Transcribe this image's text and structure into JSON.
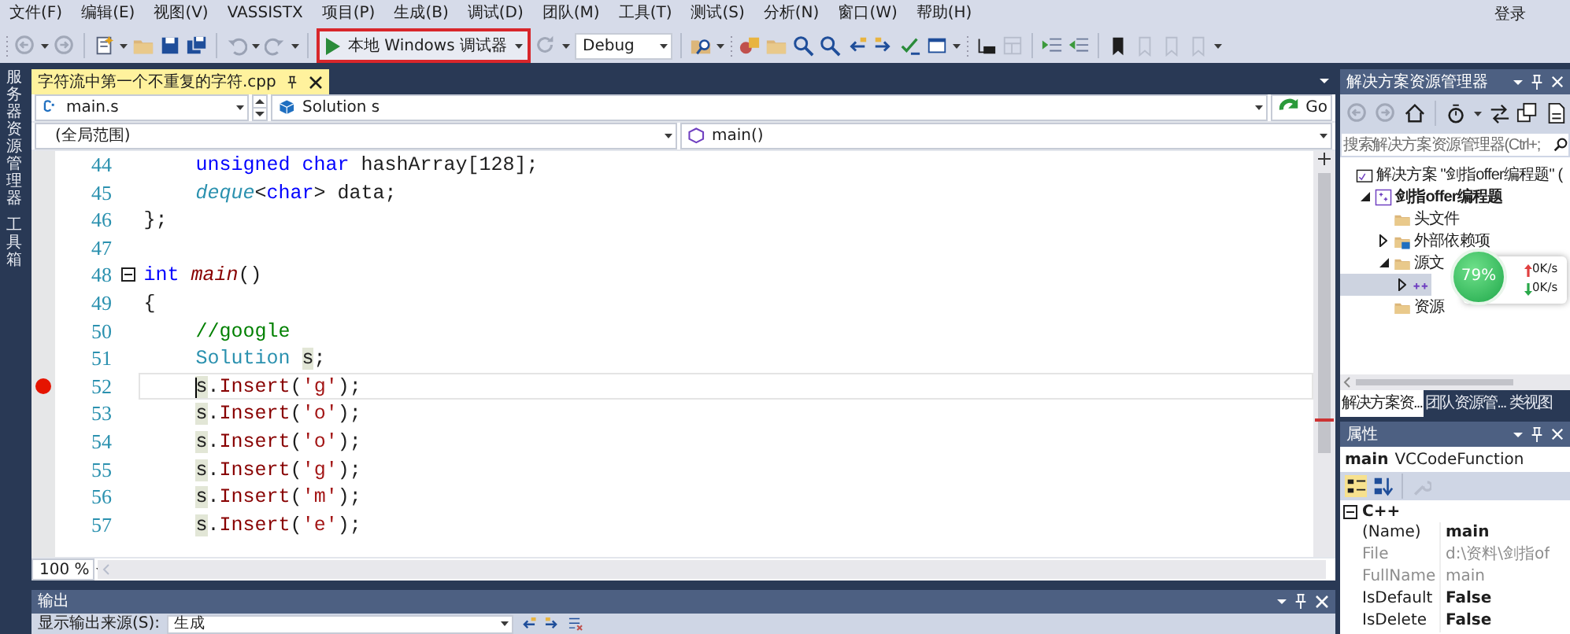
{
  "menu": [
    {
      "label": "文件(F)"
    },
    {
      "label": "编辑(E)"
    },
    {
      "label": "视图(V)"
    },
    {
      "label": "VASSISTX"
    },
    {
      "label": "项目(P)"
    },
    {
      "label": "生成(B)"
    },
    {
      "label": "调试(D)"
    },
    {
      "label": "团队(M)"
    },
    {
      "label": "工具(T)"
    },
    {
      "label": "测试(S)"
    },
    {
      "label": "分析(N)"
    },
    {
      "label": "窗口(W)"
    },
    {
      "label": "帮助(H)"
    }
  ],
  "sign_in": "登录",
  "toolbar": {
    "debug_button": "本地 Windows 调试器",
    "configuration": "Debug"
  },
  "side_tabs": [
    {
      "label": "服务器资源管理器"
    },
    {
      "label": "工具箱"
    }
  ],
  "editor": {
    "tab": {
      "title": "字符流中第一个不重复的字符.cpp",
      "selected": true
    },
    "nav": {
      "scope": "main.s",
      "type": "Solution s",
      "go": "Go",
      "context": "(全局范围)",
      "member": "main()"
    },
    "lines": [
      {
        "number": "44",
        "indented": true,
        "collapsible": false,
        "current": false,
        "tokens": [
          {
            "text": "unsigned char",
            "kind": "keyword"
          },
          {
            "text": " hashArray[128];",
            "kind": "plain"
          }
        ]
      },
      {
        "number": "45",
        "indented": true,
        "collapsible": false,
        "current": false,
        "tokens": [
          {
            "text": "deque",
            "kind": "template"
          },
          {
            "text": "<",
            "kind": "plain"
          },
          {
            "text": "char",
            "kind": "keyword"
          },
          {
            "text": "> data;",
            "kind": "plain"
          }
        ]
      },
      {
        "number": "46",
        "indented": false,
        "collapsible": false,
        "current": false,
        "tokens": [
          {
            "text": "};",
            "kind": "plain"
          }
        ]
      },
      {
        "number": "47"
      },
      {
        "number": "48",
        "indented": false,
        "collapsible": true,
        "current": false,
        "tokens": [
          {
            "text": "int ",
            "kind": "keyword"
          },
          {
            "text": "main",
            "kind": "function"
          },
          {
            "text": "()",
            "kind": "plain"
          }
        ]
      },
      {
        "number": "49",
        "indented": false,
        "collapsible": false,
        "current": false,
        "tokens": [
          {
            "text": "{",
            "kind": "plain"
          }
        ]
      },
      {
        "number": "50",
        "indented": true,
        "collapsible": false,
        "current": false,
        "tokens": [
          {
            "text": "//google",
            "kind": "comment"
          }
        ]
      },
      {
        "number": "51",
        "indented": true,
        "collapsible": false,
        "current": false,
        "tokens": [
          {
            "text": "Solution ",
            "kind": "type"
          },
          {
            "text": "s",
            "kind": "reference"
          },
          {
            "text": ";",
            "kind": "plain"
          }
        ]
      },
      {
        "number": "52",
        "indented": true,
        "collapsible": false,
        "breakpoint": true,
        "current": true,
        "tokens": [
          {
            "text": "s",
            "kind": "reference"
          },
          {
            "text": ".",
            "kind": "plain"
          },
          {
            "text": "Insert",
            "kind": "method"
          },
          {
            "text": "(",
            "kind": "plain"
          },
          {
            "text": "'g'",
            "kind": "string"
          },
          {
            "text": ");",
            "kind": "plain"
          }
        ]
      },
      {
        "number": "53",
        "indented": true,
        "collapsible": false,
        "current": false,
        "tokens": [
          {
            "text": "s",
            "kind": "reference"
          },
          {
            "text": ".",
            "kind": "plain"
          },
          {
            "text": "Insert",
            "kind": "method"
          },
          {
            "text": "(",
            "kind": "plain"
          },
          {
            "text": "'o'",
            "kind": "string"
          },
          {
            "text": ");",
            "kind": "plain"
          }
        ]
      },
      {
        "number": "54",
        "indented": true,
        "collapsible": false,
        "current": false,
        "tokens": [
          {
            "text": "s",
            "kind": "reference"
          },
          {
            "text": ".",
            "kind": "plain"
          },
          {
            "text": "Insert",
            "kind": "method"
          },
          {
            "text": "(",
            "kind": "plain"
          },
          {
            "text": "'o'",
            "kind": "string"
          },
          {
            "text": ");",
            "kind": "plain"
          }
        ]
      },
      {
        "number": "55",
        "indented": true,
        "collapsible": false,
        "current": false,
        "tokens": [
          {
            "text": "s",
            "kind": "reference"
          },
          {
            "text": ".",
            "kind": "plain"
          },
          {
            "text": "Insert",
            "kind": "method"
          },
          {
            "text": "(",
            "kind": "plain"
          },
          {
            "text": "'g'",
            "kind": "string"
          },
          {
            "text": ");",
            "kind": "plain"
          }
        ]
      },
      {
        "number": "56",
        "indented": true,
        "collapsible": false,
        "current": false,
        "tokens": [
          {
            "text": "s",
            "kind": "reference"
          },
          {
            "text": ".",
            "kind": "plain"
          },
          {
            "text": "Insert",
            "kind": "method"
          },
          {
            "text": "(",
            "kind": "plain"
          },
          {
            "text": "'m'",
            "kind": "string"
          },
          {
            "text": ");",
            "kind": "plain"
          }
        ]
      },
      {
        "number": "57",
        "indented": true,
        "collapsible": false,
        "current": false,
        "tokens": [
          {
            "text": "s",
            "kind": "reference"
          },
          {
            "text": ".",
            "kind": "plain"
          },
          {
            "text": "Insert",
            "kind": "method"
          },
          {
            "text": "(",
            "kind": "plain"
          },
          {
            "text": "'e'",
            "kind": "string"
          },
          {
            "text": ");",
            "kind": "plain"
          }
        ]
      }
    ],
    "zoom": "100 %"
  },
  "output": {
    "title": "输出",
    "source_label": "显示输出来源(S):",
    "source": "生成"
  },
  "solution_explorer": {
    "title": "解决方案资源管理器",
    "search": {
      "placeholder": "搜索解决方案资源管理器(Ctrl+;"
    },
    "tree": [
      {
        "label": "解决方案 \"剑指offer编程题\" (",
        "kind": "solution",
        "selected": false,
        "children": [
          {
            "label": "剑指offer编程题",
            "kind": "project",
            "expanded": true,
            "selected": false,
            "children": [
              {
                "label": "头文件",
                "kind": "folder",
                "selected": false
              },
              {
                "label": "外部依赖项",
                "kind": "references",
                "expanded": false,
                "selected": false
              },
              {
                "label": "源文",
                "kind": "folder",
                "expanded": true,
                "selected": false,
                "children": [
                  {
                    "kind": "cpp",
                    "expanded": false,
                    "selected": true
                  }
                ]
              },
              {
                "label": "资源",
                "kind": "folder",
                "selected": false
              }
            ]
          }
        ]
      }
    ],
    "meter": {
      "percent": "79%",
      "upload": "0K/s",
      "download": "0K/s"
    },
    "tabs": [
      {
        "label": "解决方案资...",
        "selected": true
      },
      {
        "label": "团队资源管...",
        "selected": false
      },
      {
        "label": "类视图",
        "selected": false
      }
    ]
  },
  "properties": {
    "title": "属性",
    "object": "main",
    "object_type": "VCCodeFunction",
    "category": "C++",
    "rows": [
      {
        "name": "(Name)",
        "value": "main",
        "bold": true,
        "disabled": false
      },
      {
        "name": "File",
        "value": "d:\\资料\\剑指of",
        "bold": false,
        "disabled": true
      },
      {
        "name": "FullName",
        "value": "main",
        "bold": false,
        "disabled": true
      },
      {
        "name": "IsDefault",
        "value": "False",
        "bold": true,
        "disabled": false
      },
      {
        "name": "IsDelete",
        "value": "False",
        "bold": true,
        "disabled": false
      }
    ]
  }
}
